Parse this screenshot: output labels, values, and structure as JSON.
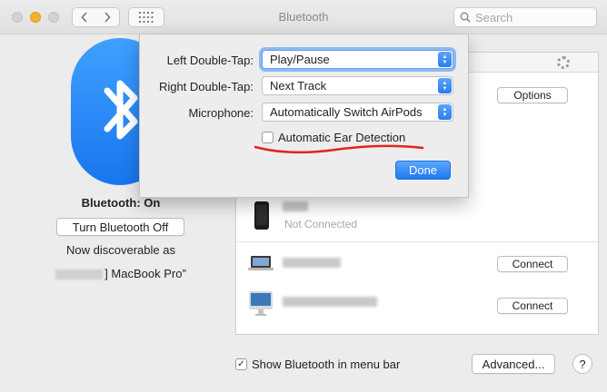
{
  "window": {
    "title": "Bluetooth",
    "search_placeholder": "Search",
    "accent_color": "#1f78ef"
  },
  "left": {
    "status": "Bluetooth: On",
    "toggle_button": "Turn Bluetooth Off",
    "discoverable_label": "Now discoverable as",
    "device_name": "] MacBook Pro”"
  },
  "devices": {
    "options_button": "Options",
    "iphone_status": "Not Connected",
    "connect_button_1": "Connect",
    "connect_button_2": "Connect",
    "icons": [
      "airpods-device",
      "iphone-icon",
      "macbook-icon",
      "imac-icon"
    ]
  },
  "bottom": {
    "show_in_menu_bar": "Show Bluetooth in menu bar",
    "show_in_menu_bar_checked": true,
    "advanced_button": "Advanced...",
    "help_button": "?"
  },
  "sheet": {
    "left_double_tap_label": "Left Double-Tap:",
    "left_double_tap_value": "Play/Pause",
    "right_double_tap_label": "Right Double-Tap:",
    "right_double_tap_value": "Next Track",
    "microphone_label": "Microphone:",
    "microphone_value": "Automatically Switch AirPods",
    "ear_detection_label": "Automatic Ear Detection",
    "ear_detection_checked": false,
    "done_button": "Done",
    "annotation_color": "#e0251b"
  }
}
